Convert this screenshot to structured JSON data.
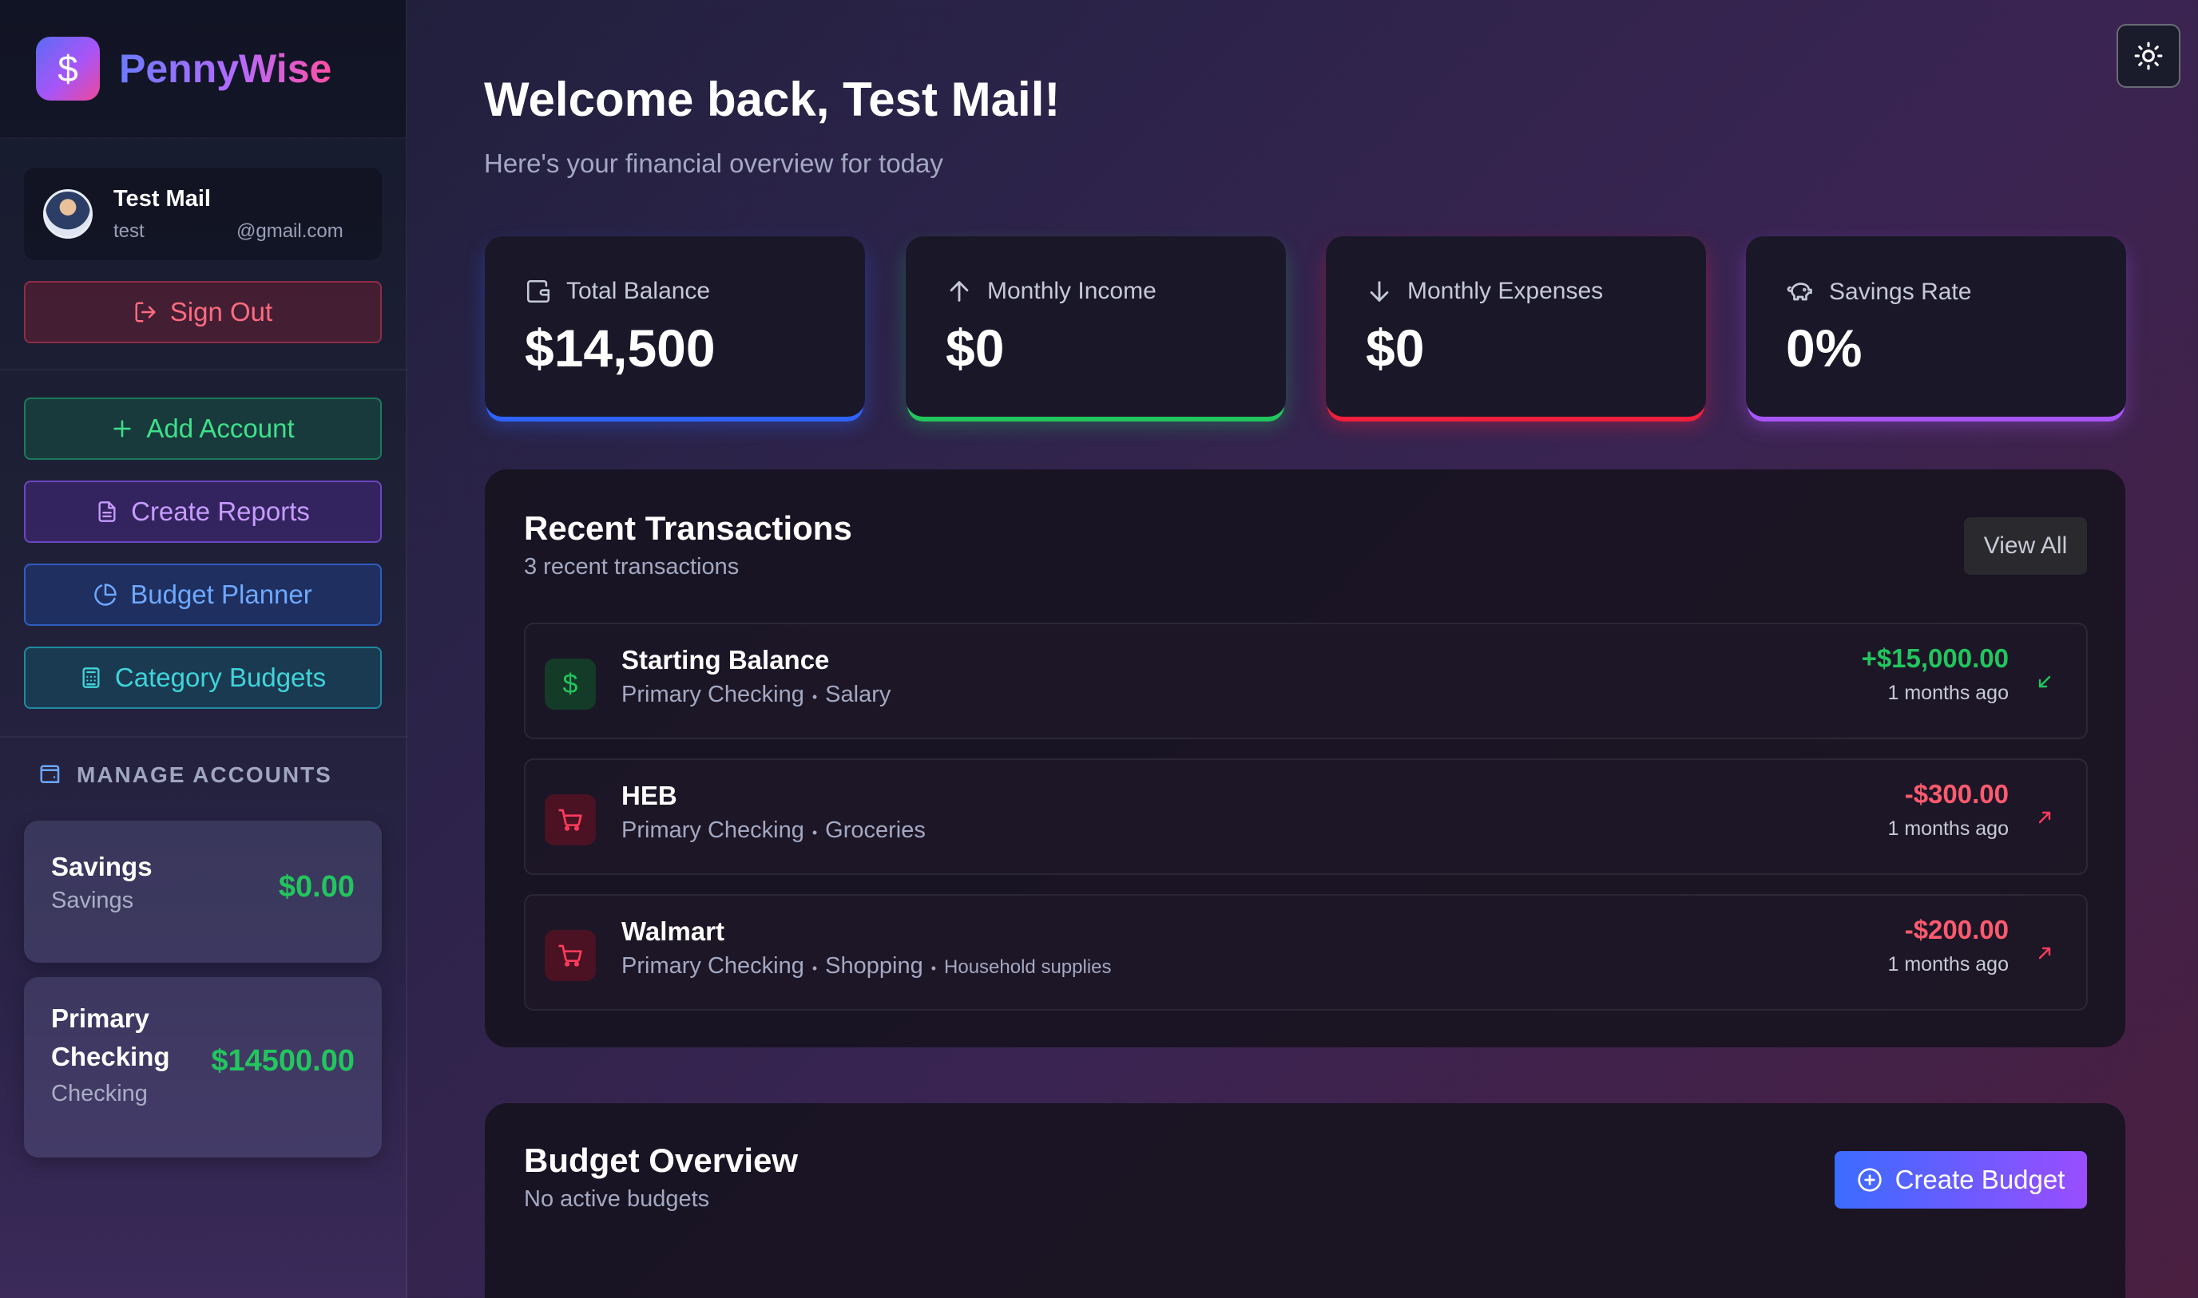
{
  "app": {
    "brand": "PennyWise",
    "brand_symbol": "$"
  },
  "user": {
    "name": "Test Mail",
    "email_local": "test",
    "email_domain": "@gmail.com"
  },
  "sidebar": {
    "sign_out": "Sign Out",
    "add_account": "Add Account",
    "create_reports": "Create Reports",
    "budget_planner": "Budget Planner",
    "category_budgets": "Category Budgets",
    "manage_accounts": "MANAGE ACCOUNTS"
  },
  "accounts": [
    {
      "name": "Savings",
      "type": "Savings",
      "balance": "$0.00"
    },
    {
      "name_line1": "Primary",
      "name_line2": "Checking",
      "type": "Checking",
      "balance": "$14500.00"
    }
  ],
  "header": {
    "welcome": "Welcome back, Test Mail!",
    "subtitle": "Here's your financial overview for today"
  },
  "stats": [
    {
      "label": "Total Balance",
      "value": "$14,500",
      "icon": "wallet-icon",
      "accent": "#2f63ff"
    },
    {
      "label": "Monthly Income",
      "value": "$0",
      "icon": "arrow-up-icon",
      "accent": "#22c55e"
    },
    {
      "label": "Monthly Expenses",
      "value": "$0",
      "icon": "arrow-down-icon",
      "accent": "#ef1f3d"
    },
    {
      "label": "Savings Rate",
      "value": "0%",
      "icon": "piggy-bank-icon",
      "accent": "#a855f7"
    }
  ],
  "transactions": {
    "title": "Recent Transactions",
    "subtitle": "3 recent transactions",
    "view_all": "View All",
    "items": [
      {
        "name": "Starting Balance",
        "account": "Primary Checking",
        "category": "Salary",
        "note": "",
        "amount": "+$15,000.00",
        "time": "1 months ago",
        "direction": "in"
      },
      {
        "name": "HEB",
        "account": "Primary Checking",
        "category": "Groceries",
        "note": "",
        "amount": "-$300.00",
        "time": "1 months ago",
        "direction": "out"
      },
      {
        "name": "Walmart",
        "account": "Primary Checking",
        "category": "Shopping",
        "note": "Household supplies",
        "amount": "-$200.00",
        "time": "1 months ago",
        "direction": "out"
      }
    ]
  },
  "budget": {
    "title": "Budget Overview",
    "subtitle": "No active budgets",
    "create": "Create Budget"
  },
  "colors": {
    "positive": "#22c55e",
    "negative": "#ff5a6e",
    "accent_blue": "#3b6cff",
    "accent_purple": "#a855f7"
  }
}
